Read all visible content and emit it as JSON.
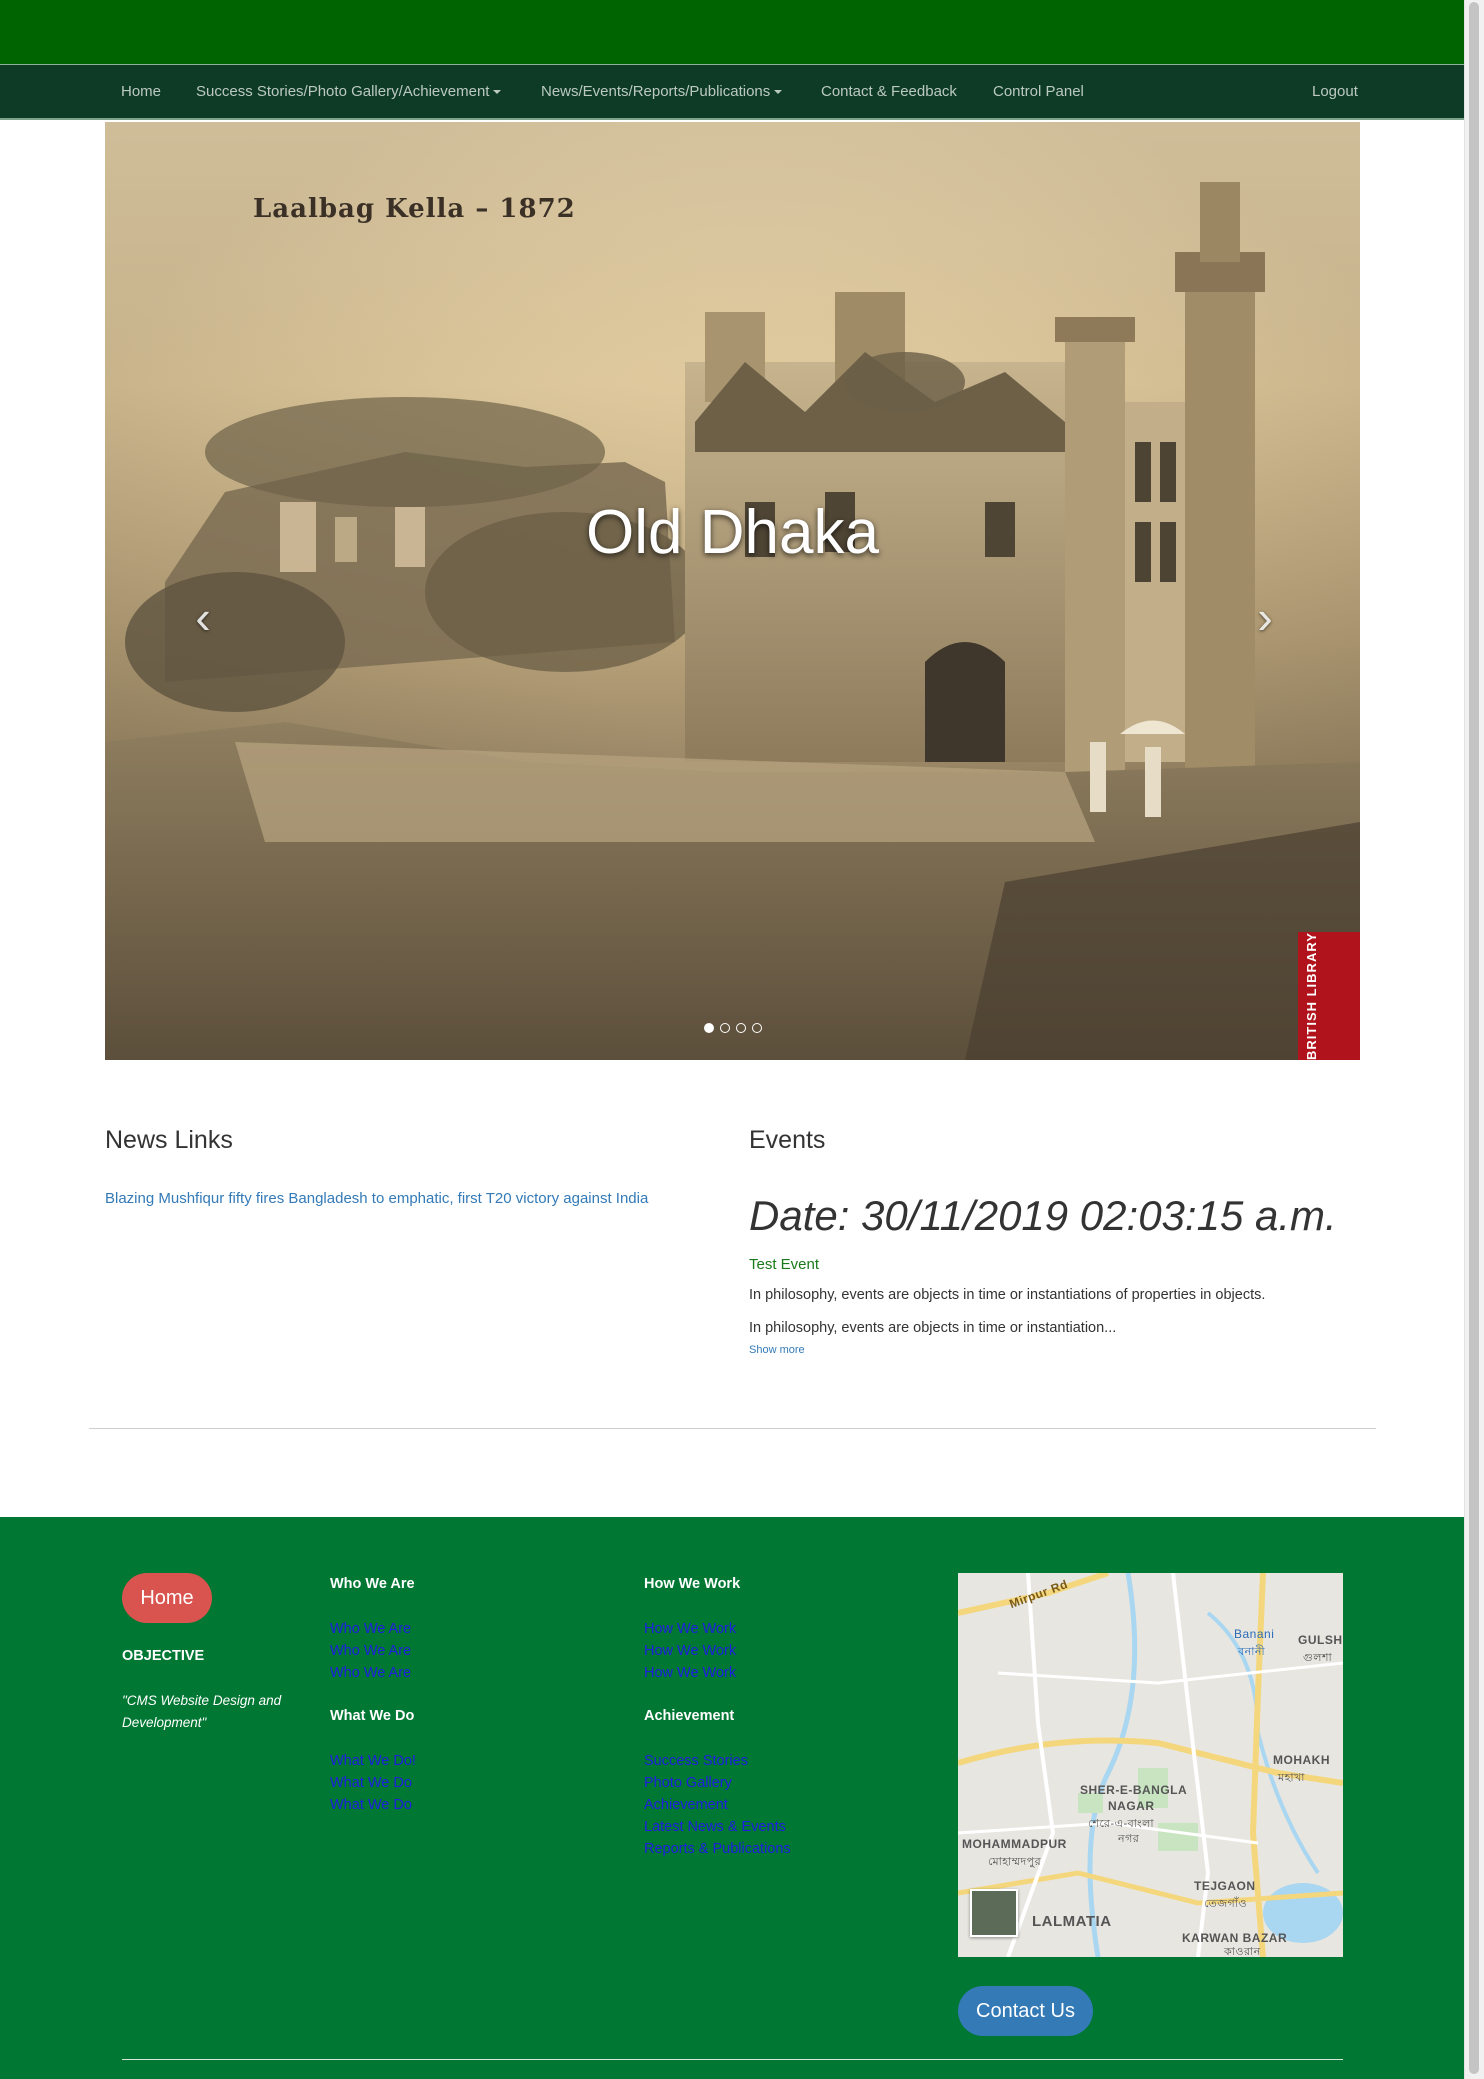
{
  "nav": {
    "items": [
      {
        "label": "Home"
      },
      {
        "label": "Success Stories/Photo Gallery/Achievement",
        "dropdown": true
      },
      {
        "label": "News/Events/Reports/Publications",
        "dropdown": true
      },
      {
        "label": "Contact & Feedback"
      },
      {
        "label": "Control Panel"
      }
    ],
    "logout": "Logout"
  },
  "carousel": {
    "photo_caption": "Laalbag Kella – 1872",
    "title": "Old Dhaka",
    "watermark": "BRITISH LIBRARY",
    "prev_icon": "chevron-left-icon",
    "next_icon": "chevron-right-icon",
    "slide_count": 4,
    "active_index": 0
  },
  "news": {
    "heading": "News Links",
    "link": "Blazing Mushfiqur fifty fires Bangladesh to emphatic, first T20 victory against India"
  },
  "events": {
    "heading": "Events",
    "date": "Date: 30/11/2019 02:03:15 a.m.",
    "name": "Test Event",
    "description": "In philosophy, events are objects in time or instantiations of properties in objects.",
    "excerpt": "In philosophy, events are objects in time or instantiation...",
    "show_more": "Show more"
  },
  "footer": {
    "home_button": "Home",
    "objective_title": "OBJECTIVE",
    "objective_text": "\"CMS Website Design and Development\"",
    "who_we_are": {
      "heading": "Who We Are",
      "links": [
        "Who We Are",
        "Who We Are",
        "Who We Are"
      ]
    },
    "what_we_do": {
      "heading": "What We Do",
      "links": [
        "What We Do!",
        "What We Do",
        "What We Do"
      ]
    },
    "how_we_work": {
      "heading": "How We Work",
      "links": [
        "How We Work",
        "How We Work",
        "How We Work"
      ]
    },
    "achievement": {
      "heading": "Achievement",
      "links": [
        "Success Stories",
        "Photo Gallery",
        "Achievement",
        "Latest News & Events",
        "Reports & Publications"
      ]
    },
    "map": {
      "labels": [
        "Mirpur Rd",
        "Banani",
        "বনানী",
        "GULSH",
        "গুলশা",
        "MOHAKH",
        "মহাখা",
        "SHER-E-BANGLA",
        "NAGAR",
        "শেরে-এ-বাংলা",
        "নগর",
        "MOHAMMADPUR",
        "মোহাম্মদপুর",
        "TEJGAON",
        "তেজগাঁও",
        "LALMATIA",
        "KARWAN BAZAR",
        "কাওরান"
      ]
    },
    "contact_button": "Contact Us"
  },
  "colors": {
    "topbar": "#006400",
    "navbar": "#0d3b26",
    "footer": "#007733",
    "home_button": "#d9534f",
    "contact_button": "#337ab7",
    "link": "#337ab7",
    "footer_link": "#1f1fe0"
  }
}
